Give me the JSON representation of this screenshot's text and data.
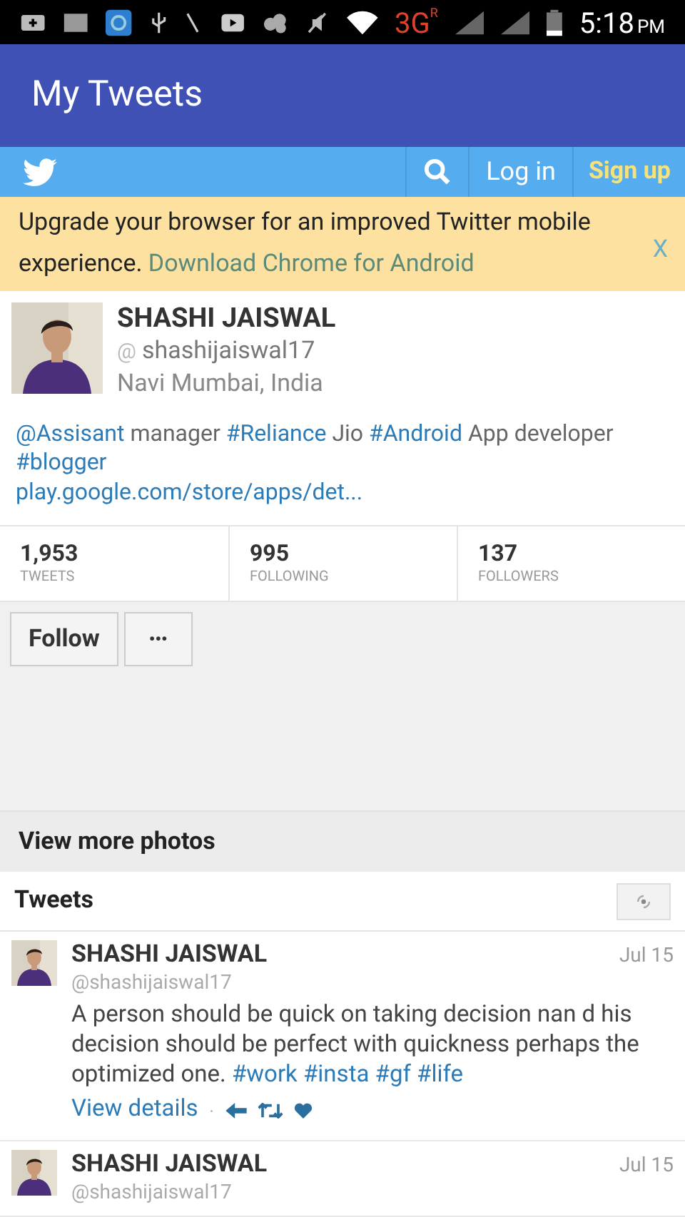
{
  "status_bar": {
    "network": "3G",
    "roaming": "R",
    "time": "5:18",
    "ampm": "PM"
  },
  "title_bar": {
    "title": "My Tweets"
  },
  "nav": {
    "login": "Log in",
    "signup": "Sign up"
  },
  "banner": {
    "text": "Upgrade your browser for an improved Twitter mobile experience.",
    "link": "Download Chrome for Android",
    "close": "X"
  },
  "profile": {
    "name": "SHASHI JAISWAL",
    "at": "@",
    "handle": "shashijaiswal17",
    "location": "Navi Mumbai, India",
    "bio": [
      {
        "kind": "link",
        "text": "@Assisant"
      },
      {
        "kind": "text",
        "text": " manager "
      },
      {
        "kind": "link",
        "text": "#Reliance"
      },
      {
        "kind": "text",
        "text": " Jio "
      },
      {
        "kind": "link",
        "text": "#Android"
      },
      {
        "kind": "text",
        "text": " App developer "
      },
      {
        "kind": "link",
        "text": "#blogger"
      }
    ],
    "url": "play.google.com/store/apps/det..."
  },
  "stats": [
    {
      "value": "1,953",
      "label": "TWEETS"
    },
    {
      "value": "995",
      "label": "FOLLOWING"
    },
    {
      "value": "137",
      "label": "FOLLOWERS"
    }
  ],
  "actions": {
    "follow": "Follow",
    "more": "•••"
  },
  "photos_link": "View more photos",
  "tweets_header": "Tweets",
  "tweets": [
    {
      "name": "SHASHI JAISWAL",
      "handle": "@shashijaiswal17",
      "date": "Jul 15",
      "text": [
        {
          "kind": "text",
          "text": "A person should be quick on taking decision nan d his decision should be perfect with quickness perhaps the optimized one. "
        },
        {
          "kind": "link",
          "text": "#work #insta #gf #life"
        }
      ],
      "details": "View details",
      "sep": "·"
    },
    {
      "name": "SHASHI JAISWAL",
      "handle": "@shashijaiswal17",
      "date": "Jul 15"
    }
  ]
}
